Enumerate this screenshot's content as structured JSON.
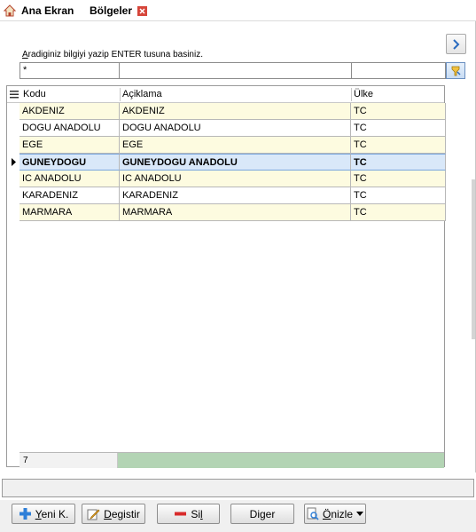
{
  "tabs": [
    {
      "label": "Ana Ekran",
      "icon": "home-icon"
    },
    {
      "label": "Bölgeler",
      "icon": "close-icon"
    }
  ],
  "search": {
    "hint_first": "A",
    "hint_rest": "radiginiz bilgiyi yazip ENTER tusuna basiniz.",
    "filter_value": "*"
  },
  "grid": {
    "columns": [
      "Kodu",
      "Açiklama",
      "Ülke"
    ],
    "rows": [
      {
        "kodu": "AKDENIZ",
        "aciklama": "AKDENIZ",
        "ulke": "TC"
      },
      {
        "kodu": "DOGU ANADOLU",
        "aciklama": "DOGU ANADOLU",
        "ulke": "TC"
      },
      {
        "kodu": "EGE",
        "aciklama": "EGE",
        "ulke": "TC"
      },
      {
        "kodu": "GUNEYDOGU",
        "aciklama": "GUNEYDOGU ANADOLU",
        "ulke": "TC"
      },
      {
        "kodu": "IC ANADOLU",
        "aciklama": "IC ANADOLU",
        "ulke": "TC"
      },
      {
        "kodu": "KARADENIZ",
        "aciklama": "KARADENIZ",
        "ulke": "TC"
      },
      {
        "kodu": "MARMARA",
        "aciklama": "MARMARA",
        "ulke": "TC"
      }
    ],
    "selected_index": 3,
    "record_count": "7"
  },
  "buttons": {
    "new": {
      "pre": "",
      "ul": "Y",
      "post": "eni K."
    },
    "edit": {
      "pre": "",
      "ul": "D",
      "post": "egistir"
    },
    "delete": {
      "pre": "Si",
      "ul": "l",
      "post": ""
    },
    "other": {
      "pre": "Diger",
      "ul": "",
      "post": ""
    },
    "preview": {
      "pre": "",
      "ul": "Ö",
      "post": "nizle"
    }
  },
  "colors": {
    "odd_row": "#fdfbe0",
    "selected_row": "#d9e8f9",
    "footer_bar": "#b3d4b4",
    "accent": "#2a6bbf"
  }
}
